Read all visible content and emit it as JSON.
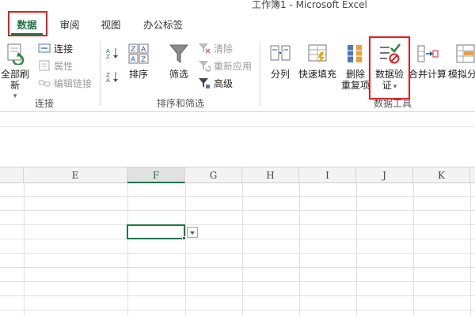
{
  "window": {
    "title": "工作簿1 - Microsoft Excel"
  },
  "tabs": [
    {
      "label": "数据",
      "active": true
    },
    {
      "label": "审阅",
      "active": false
    },
    {
      "label": "视图",
      "active": false
    },
    {
      "label": "办公标签",
      "active": false
    }
  ],
  "ribbon": {
    "connections": {
      "refresh_all": "全部刷新",
      "connections": "连接",
      "properties": "属性",
      "edit_links": "编辑链接",
      "group_label": "连接"
    },
    "sort_filter": {
      "sort": "排序",
      "filter": "筛选",
      "clear": "清除",
      "reapply": "重新应用",
      "advanced": "高级",
      "group_label": "排序和筛选"
    },
    "data_tools": {
      "text_to_columns": "分列",
      "flash_fill": "快速填充",
      "remove_duplicates_1": "删除",
      "remove_duplicates_2": "重复项",
      "data_validation_1": "数据验",
      "data_validation_2": "证",
      "consolidate": "合并计算",
      "what_if": "模拟分",
      "group_label": "数据工具"
    }
  },
  "sheet": {
    "columns": [
      "E",
      "F",
      "G",
      "H",
      "I",
      "J",
      "K"
    ],
    "selected_column": "F"
  },
  "colors": {
    "accent": "#217346",
    "highlight": "#e02020"
  }
}
